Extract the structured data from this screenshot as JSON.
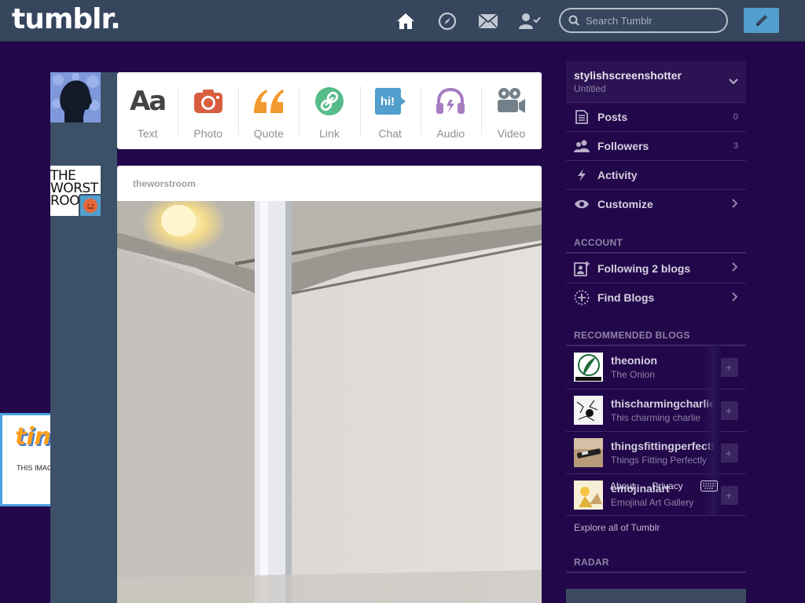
{
  "header": {
    "logo": "tumblr.",
    "nav": [
      {
        "name": "home-icon"
      },
      {
        "name": "compass-icon"
      },
      {
        "name": "mail-icon"
      },
      {
        "name": "account-icon"
      }
    ],
    "search_placeholder": "Search Tumblr",
    "compose_icon": "pencil-icon"
  },
  "post_types": [
    {
      "label": "Text",
      "icon": "text-icon",
      "color": "#444444"
    },
    {
      "label": "Photo",
      "icon": "camera-icon",
      "color": "#d95e40"
    },
    {
      "label": "Quote",
      "icon": "quote-icon",
      "color": "#f2992e"
    },
    {
      "label": "Link",
      "icon": "link-icon",
      "color": "#56bc8a"
    },
    {
      "label": "Chat",
      "icon": "chat-icon",
      "color": "#529ecc"
    },
    {
      "label": "Audio",
      "icon": "headphones-icon",
      "color": "#a77dc2"
    },
    {
      "label": "Video",
      "icon": "video-camera-icon",
      "color": "#748089"
    }
  ],
  "post": {
    "author": "theworstroom",
    "avatar_text": "THE WORST ROO"
  },
  "ad": {
    "logo": "tiny",
    "text": "THIS IMAGE HAS MOVED O"
  },
  "sidebar": {
    "blog_name": "stylishscreenshotter",
    "blog_title": "Untitled",
    "menu": [
      {
        "label": "Posts",
        "count": "0",
        "icon": "document-icon"
      },
      {
        "label": "Followers",
        "count": "3",
        "icon": "people-icon"
      },
      {
        "label": "Activity",
        "count": "",
        "icon": "lightning-icon"
      },
      {
        "label": "Customize",
        "count": "",
        "icon": "eye-icon"
      }
    ],
    "account_title": "ACCOUNT",
    "account_items": [
      {
        "label": "Following 2 blogs",
        "icon": "add-person-icon"
      },
      {
        "label": "Find Blogs",
        "icon": "compass-dotted-icon"
      }
    ],
    "recommended_title": "RECOMMENDED BLOGS",
    "recommended": [
      {
        "name": "theonion",
        "title": "The Onion"
      },
      {
        "name": "thischarmingcharlie",
        "title": "This charming charlie"
      },
      {
        "name": "thingsfittingperfectly",
        "title": "Things Fitting Perfectly"
      },
      {
        "name": "emojinalart",
        "title": "Emojinal Art Gallery"
      }
    ],
    "explore": "Explore all of Tumblr",
    "radar_title": "RADAR"
  },
  "footer": {
    "about": "About",
    "privacy": "Privacy"
  },
  "colors": {
    "background": "#22084a",
    "header": "#36465d",
    "accent": "#529ecc"
  }
}
